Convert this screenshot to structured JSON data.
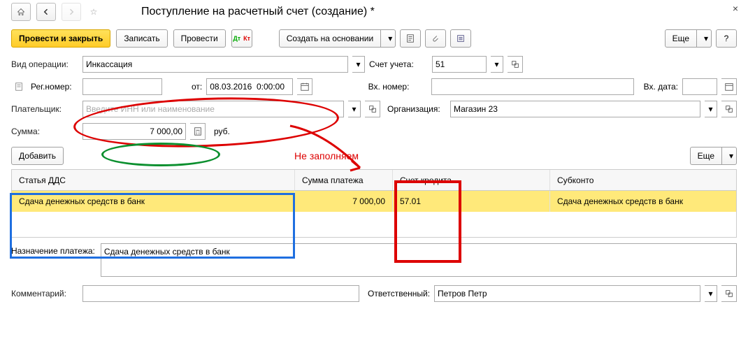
{
  "title": "Поступление на расчетный счет (создание) *",
  "toolbar": {
    "post_close": "Провести и закрыть",
    "save": "Записать",
    "post": "Провести",
    "create_based": "Создать на основании",
    "more": "Еще",
    "help": "?"
  },
  "labels": {
    "op_type": "Вид операции:",
    "reg_no": "Рег.номер:",
    "from": "от:",
    "payer": "Плательщик:",
    "amount": "Сумма:",
    "currency": "руб.",
    "account": "Счет учета:",
    "in_no": "Вх. номер:",
    "in_date": "Вх. дата:",
    "org": "Организация:",
    "add": "Добавить",
    "more2": "Еще",
    "purpose": "Назначение платежа:",
    "comment": "Комментарий:",
    "responsible": "Ответственный:"
  },
  "values": {
    "op_type": "Инкассация",
    "date": "08.03.2016  0:00:00",
    "amount": "7 000,00",
    "account": "51",
    "org": "Магазин 23",
    "purpose_text": "Сдача денежных средств в банк",
    "responsible": "Петров Петр",
    "payer_placeholder": "Введите ИНН или наименование"
  },
  "table": {
    "headers": {
      "dds": "Статья ДДС",
      "sum": "Сумма платежа",
      "credit": "Счет кредита",
      "sub": "Субконто"
    },
    "row": {
      "dds": "Сдача денежных средств в банк",
      "sum": "7 000,00",
      "credit": "57.01",
      "sub": "Сдача денежных средств в банк"
    }
  },
  "annotations": {
    "no_fill": "Не заполняем"
  }
}
